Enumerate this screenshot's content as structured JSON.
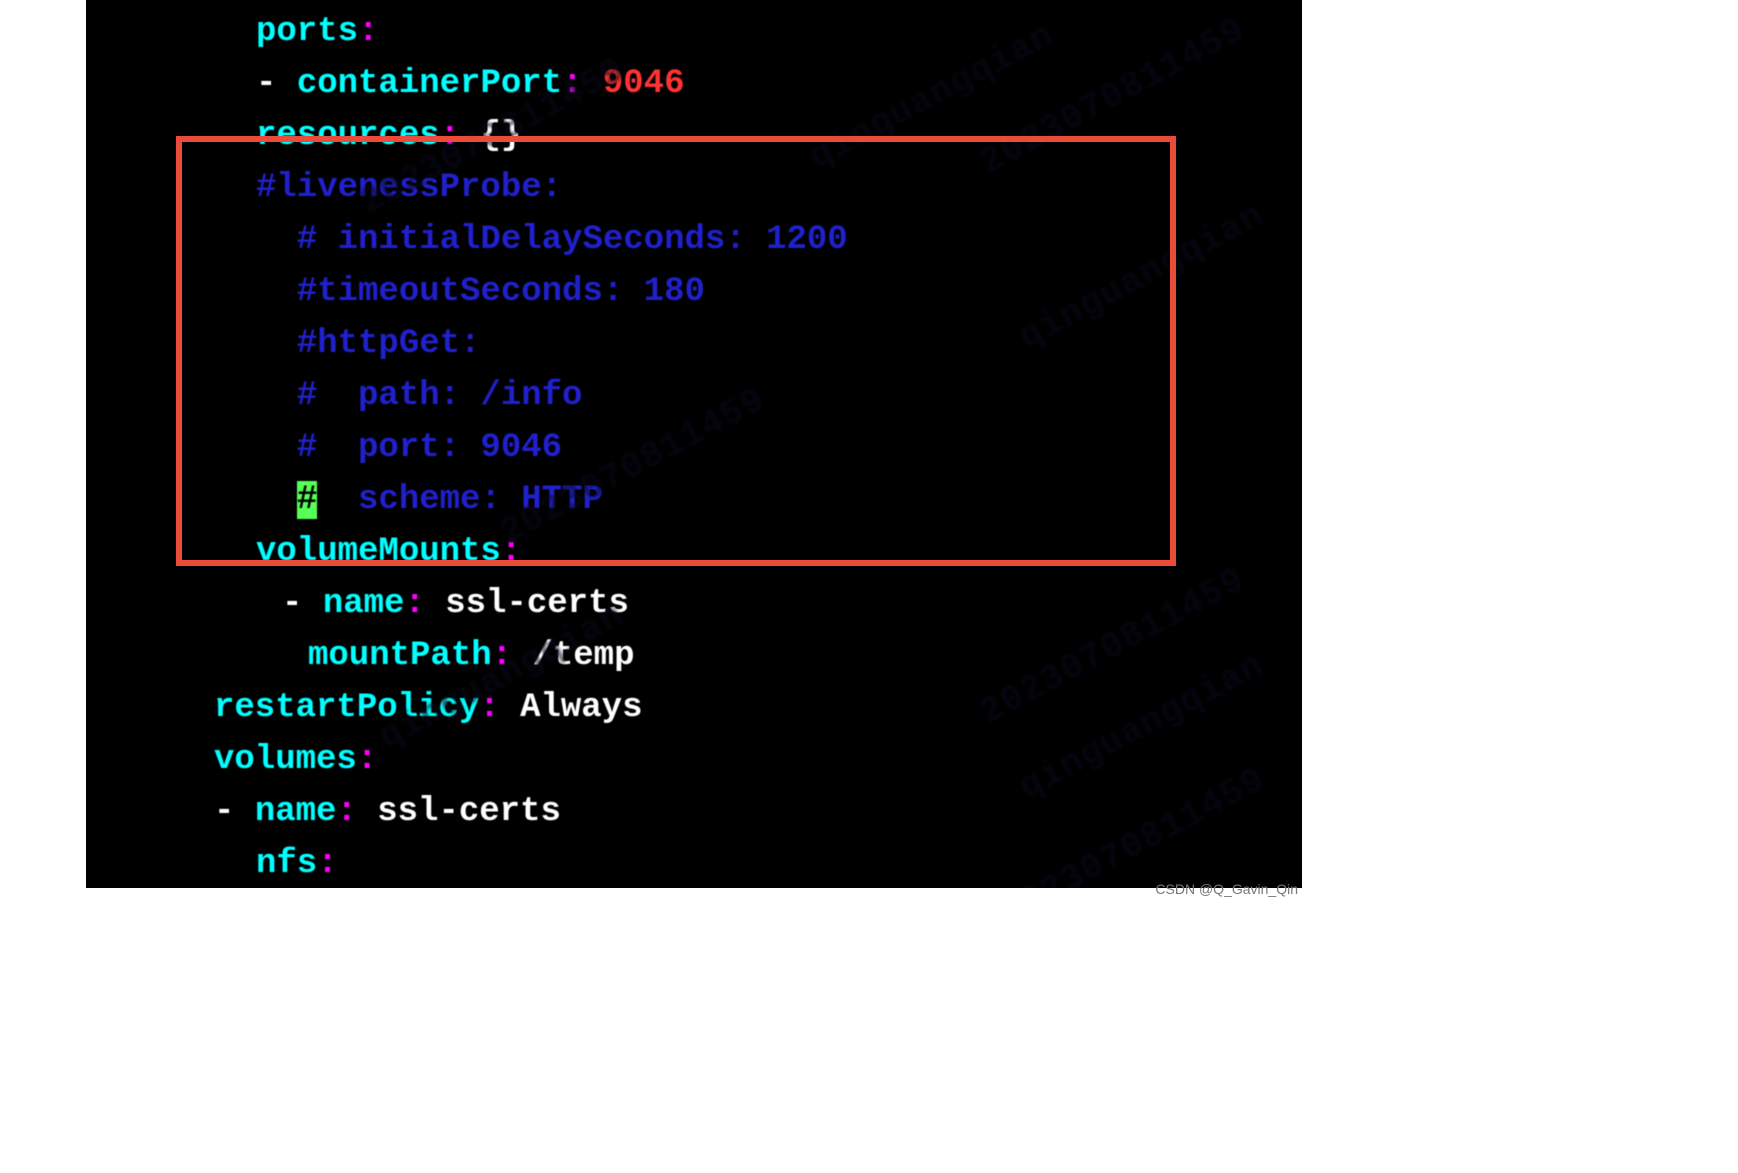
{
  "code": {
    "l1_key": "ports",
    "l1_colon": ":",
    "l2_dash": "- ",
    "l2_key": "containerPort",
    "l2_colon": ": ",
    "l2_val": "9046",
    "l3_key": "resources",
    "l3_colon": ": ",
    "l3_val": "{}",
    "l4": "#livenessProbe:",
    "l5": "  # initialDelaySeconds: 1200",
    "l6": "  #timeoutSeconds: 180",
    "l7": "  #httpGet:",
    "l8": "  #  path: /info",
    "l9": "  #  port: 9046",
    "l10a": "  ",
    "l10b": "#",
    "l10c": "  scheme: HTTP",
    "l11_key": "volumeMounts",
    "l11_colon": ":",
    "l12_dash": "- ",
    "l12_key": "name",
    "l12_colon": ": ",
    "l12_val": "ssl-certs",
    "l13_key": "mountPath",
    "l13_colon": ": ",
    "l13_val": "/temp",
    "l14_key": "restartPolicy",
    "l14_colon": ": ",
    "l14_val": "Always",
    "l15_key": "volumes",
    "l15_colon": ":",
    "l16_dash": "- ",
    "l16_key": "name",
    "l16_colon": ": ",
    "l16_val": "ssl-certs",
    "l17_key": "nfs",
    "l17_colon": ":"
  },
  "watermarks": {
    "w1": "2023070811459",
    "w2": "qinguangqian",
    "w3": "2023070811459",
    "w4": "qinguangqian",
    "w5": "2023070811459",
    "w6": "qinguangqian",
    "w7": "2023070811459",
    "w8": "qinguangqian"
  },
  "footer": "CSDN @Q_Gavin_Qin"
}
